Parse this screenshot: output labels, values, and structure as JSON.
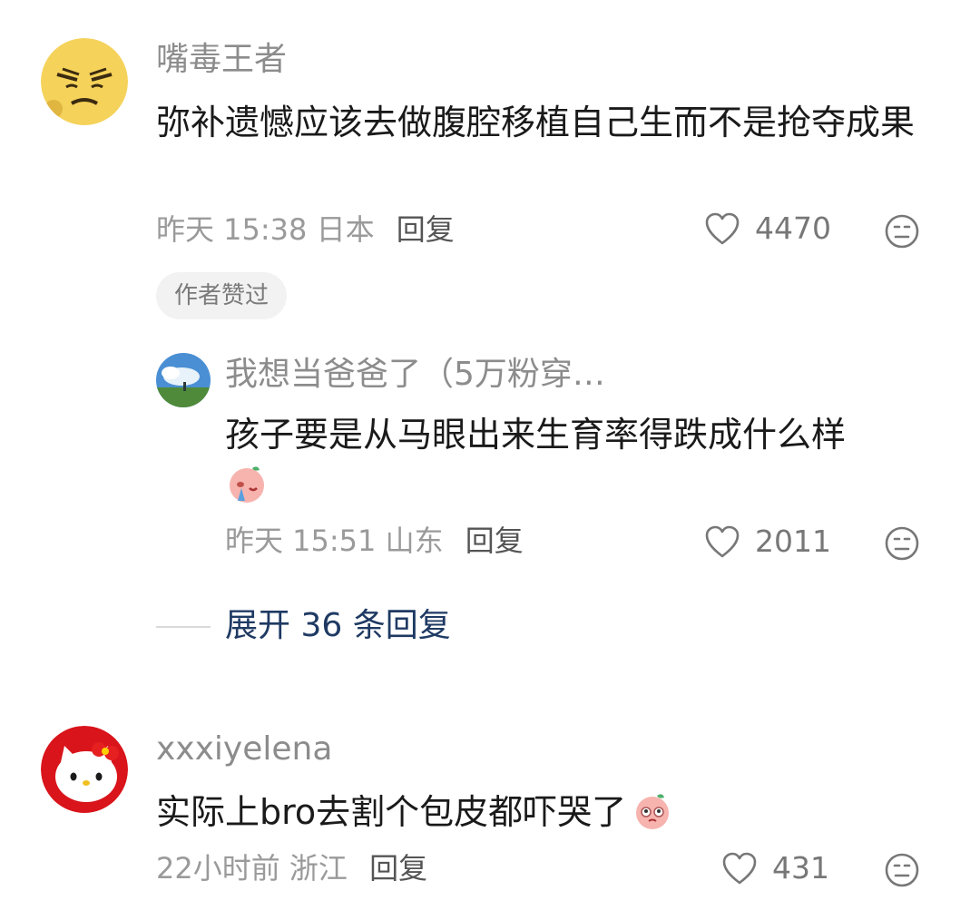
{
  "comments": [
    {
      "username": "嘴毒王者",
      "text": "弥补遗憾应该去做腹腔移植自己生而不是抢夺成果",
      "time": "昨天 15:38",
      "location": "日本",
      "reply_label": "回复",
      "likes": "4470",
      "badge": "作者赞过",
      "avatar_icon": "angry-face-avatar-icon"
    },
    {
      "username": "我想当爸爸了（5万粉穿…",
      "text": "孩子要是从马眼出来生育率得跌成什么样",
      "emoji": "crying-peach-emoji-icon",
      "time": "昨天 15:51",
      "location": "山东",
      "reply_label": "回复",
      "likes": "2011",
      "avatar_icon": "sky-landscape-avatar-icon"
    },
    {
      "username": "xxxiyelena",
      "text": "实际上bro去割个包皮都吓哭了",
      "emoji": "peach-face-emoji-icon",
      "time": "22小时前",
      "location": "浙江",
      "reply_label": "回复",
      "likes": "431",
      "avatar_icon": "hello-kitty-avatar-icon"
    }
  ],
  "expand_replies": "展开 36 条回复",
  "colors": {
    "text": "#1a1a1a",
    "muted": "#9a9a9a",
    "link": "#1f3a63"
  }
}
